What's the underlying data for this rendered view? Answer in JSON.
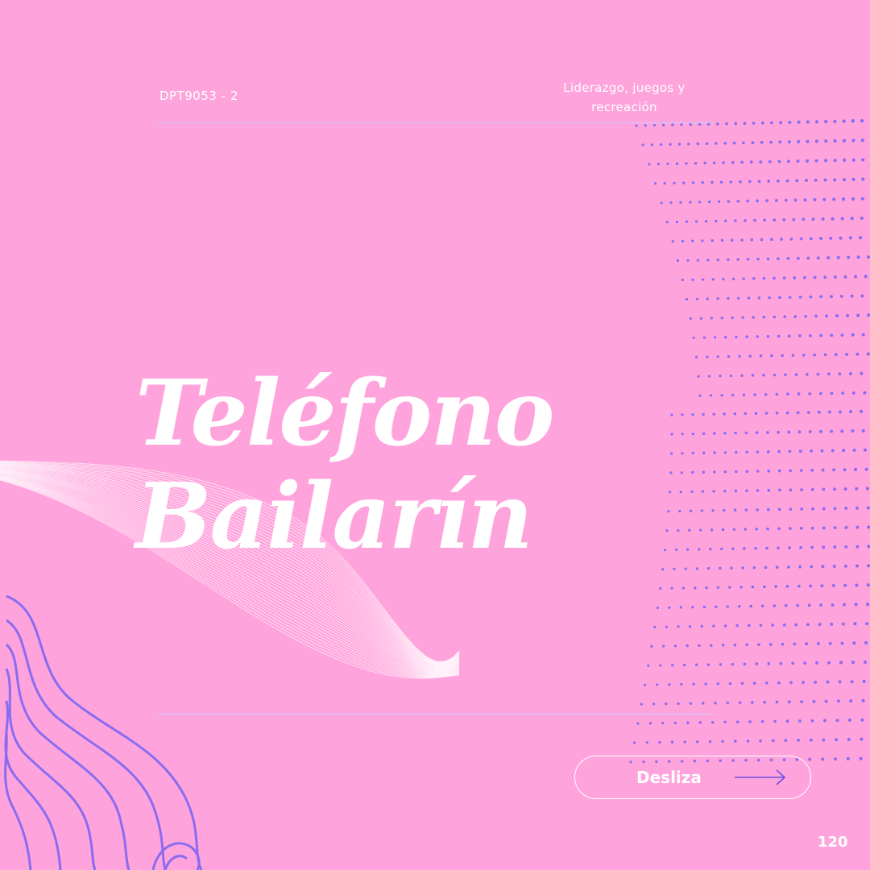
{
  "header": {
    "code": "DPT9053 - 2",
    "course_line1": "Liderazgo, juegos y",
    "course_line2": "recreación"
  },
  "title": {
    "line1": "Teléfono",
    "line2": "Bailarín"
  },
  "swipe_button": {
    "label": "Desliza",
    "icon": "arrow-right-icon"
  },
  "page_number": "120",
  "colors": {
    "background": "#ffa3dc",
    "accent": "#8a6cf0",
    "text": "#ffffff"
  }
}
